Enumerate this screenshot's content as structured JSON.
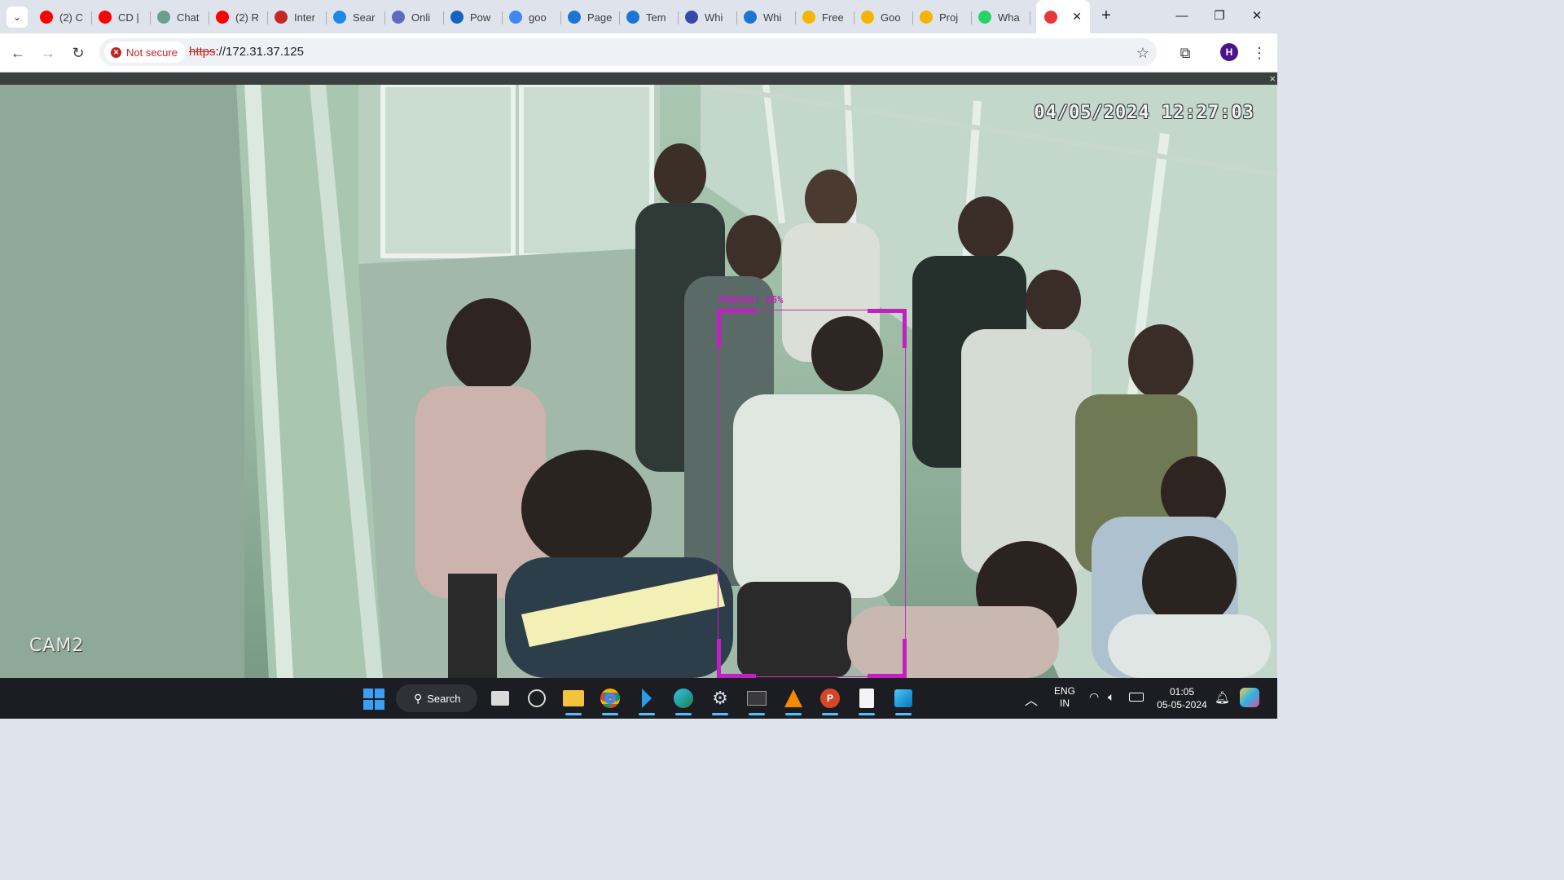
{
  "browser": {
    "tabs": [
      {
        "title": "(2) C",
        "icon": "youtube-icon",
        "color": "#ff0000"
      },
      {
        "title": "CD |",
        "icon": "youtube-icon",
        "color": "#ff0000"
      },
      {
        "title": "Chat",
        "icon": "chatgpt-icon",
        "color": "#6b9e8f"
      },
      {
        "title": "(2) R",
        "icon": "youtube-icon",
        "color": "#ff0000"
      },
      {
        "title": "Inter",
        "icon": "gauge-icon",
        "color": "#c62828"
      },
      {
        "title": "Sear",
        "icon": "v-logo-icon",
        "color": "#1e88e5"
      },
      {
        "title": "Onli",
        "icon": "blue-circle-icon",
        "color": "#5c6bc0"
      },
      {
        "title": "Pow",
        "icon": "forms-icon",
        "color": "#1565c0"
      },
      {
        "title": "goo",
        "icon": "google-icon",
        "color": "#4285f4"
      },
      {
        "title": "Page",
        "icon": "c-logo-icon",
        "color": "#1976d2"
      },
      {
        "title": "Tem",
        "icon": "c-logo-icon",
        "color": "#1976d2"
      },
      {
        "title": "Whi",
        "icon": "whiteboard-icon",
        "color": "#3949ab"
      },
      {
        "title": "Whi",
        "icon": "c-logo-icon",
        "color": "#1976d2"
      },
      {
        "title": "Free",
        "icon": "slides-icon",
        "color": "#f4b400"
      },
      {
        "title": "Goo",
        "icon": "slides-icon",
        "color": "#f4b400"
      },
      {
        "title": "Proj",
        "icon": "slides-icon",
        "color": "#f4b400"
      },
      {
        "title": "Wha",
        "icon": "whatsapp-icon",
        "color": "#25d366"
      },
      {
        "title": "",
        "icon": "camera-app-icon",
        "color": "#e53935",
        "active": true
      }
    ],
    "security_chip": "Not secure",
    "url_scheme": "https",
    "url_rest": "://172.31.37.125",
    "profile_initial": "H",
    "page_close": "×"
  },
  "feed": {
    "timestamp": "04/05/2024 12:27:03",
    "camera_label": "CAM2",
    "detection_label": "PERSON: 85%",
    "detection_color": "#c320c3"
  },
  "taskbar": {
    "search_label": "Search",
    "language_top": "ENG",
    "language_bottom": "IN",
    "time": "01:05",
    "date": "05-05-2024",
    "pinned_apps": [
      "windows-start-icon",
      "task-view-icon",
      "copilot-icon",
      "file-explorer-icon",
      "chrome-icon",
      "vscode-icon",
      "edge-icon",
      "settings-icon",
      "terminal-icon",
      "vlc-icon",
      "powerpoint-icon",
      "notepad-icon",
      "photos-icon"
    ]
  }
}
